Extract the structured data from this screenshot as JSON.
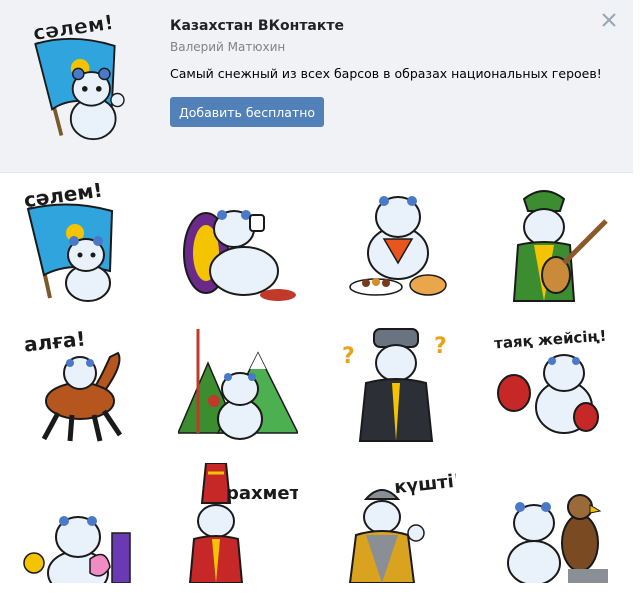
{
  "header": {
    "title": "Казахстан ВКонтакте",
    "author": "Валерий Матюхин",
    "description": "Самый снежный из всех барсов в образах национальных героев!",
    "add_button_label": "Добавить бесплатно"
  },
  "stickers": [
    {
      "name": "sticker-salem",
      "caption": "сәлем!"
    },
    {
      "name": "sticker-tea",
      "caption": ""
    },
    {
      "name": "sticker-dastarkhan",
      "caption": ""
    },
    {
      "name": "sticker-dombra",
      "caption": ""
    },
    {
      "name": "sticker-horse",
      "caption": "алға!"
    },
    {
      "name": "sticker-mountains",
      "caption": ""
    },
    {
      "name": "sticker-question",
      "caption": ""
    },
    {
      "name": "sticker-boxing",
      "caption": "таяқ жейсің!"
    },
    {
      "name": "sticker-city",
      "caption": ""
    },
    {
      "name": "sticker-rakhmet",
      "caption": "рахмет"
    },
    {
      "name": "sticker-warrior",
      "caption": "күшті!"
    },
    {
      "name": "sticker-eagle",
      "caption": ""
    }
  ],
  "colors": {
    "accent": "#5181b8",
    "header_bg": "#f0f2f5",
    "flag_blue": "#2fa4dd",
    "sun_yellow": "#f5c400",
    "leopard_fur": "#e9f2fb",
    "leopard_spots": "#4a79c7"
  },
  "icons": {
    "close": "close-icon"
  }
}
